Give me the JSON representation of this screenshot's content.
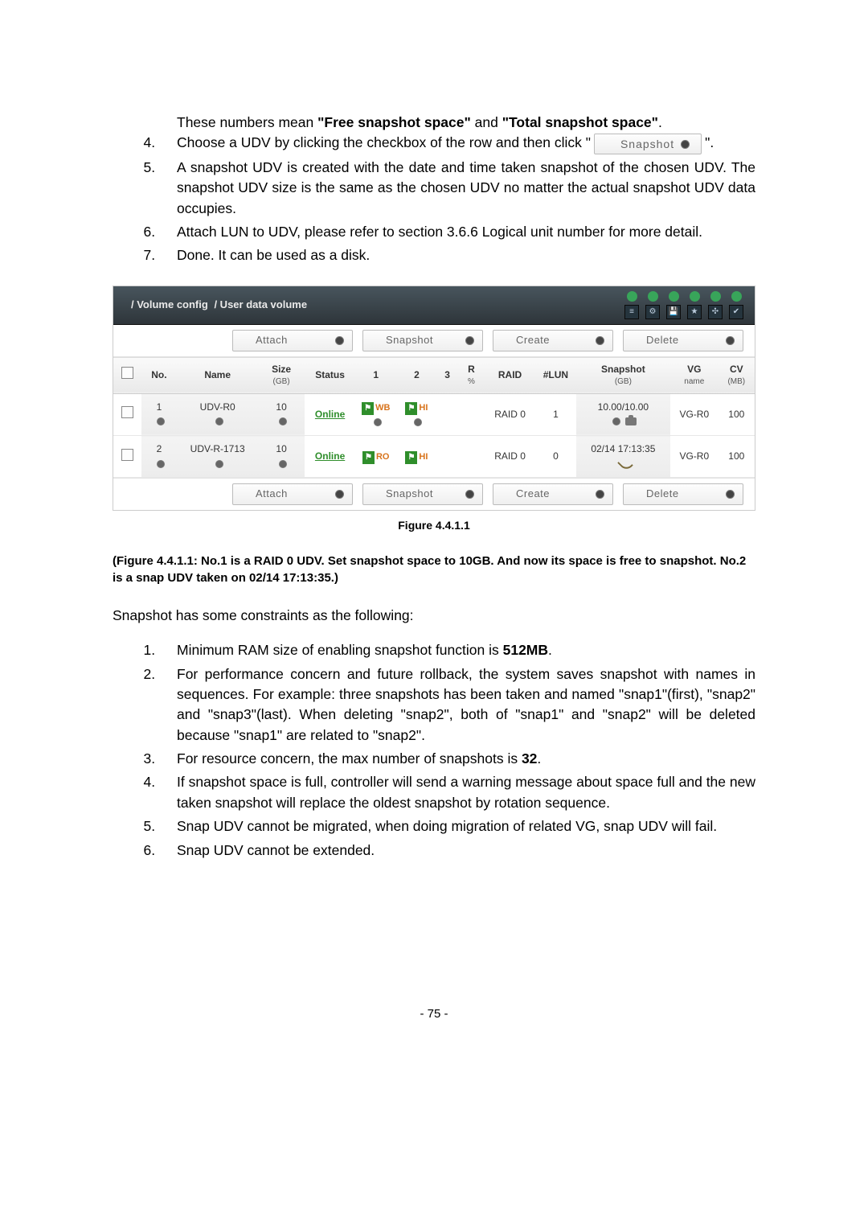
{
  "intro": {
    "line1_pre": "These numbers mean ",
    "bold1": "\"Free snapshot space\"",
    "mid": " and ",
    "bold2": "\"Total snapshot space\"",
    "post": "."
  },
  "ol1": {
    "item4_pre": "Choose a UDV by clicking the checkbox of the row and then click \"",
    "snapshot_btn": "Snapshot",
    "item4_post": "\".",
    "item5": "A snapshot UDV is created with the date and time taken snapshot of the chosen UDV. The snapshot UDV size is the same as the chosen UDV no matter the actual snapshot UDV data occupies.",
    "item6": "Attach LUN to UDV, please refer to section 3.6.6 Logical unit number for more detail.",
    "item7": "Done. It can be used as a disk."
  },
  "breadcrumb": [
    "/ Volume config",
    "/ User data volume"
  ],
  "actions": {
    "attach": "Attach",
    "snapshot": "Snapshot",
    "create": "Create",
    "delete": "Delete"
  },
  "thead": {
    "no": "No.",
    "name": "Name",
    "size": "Size",
    "size_sub": "(GB)",
    "status": "Status",
    "c1": "1",
    "c2": "2",
    "c3": "3",
    "r": "R",
    "r_sub": "%",
    "raid": "RAID",
    "lun": "#LUN",
    "snap": "Snapshot",
    "snap_sub": "(GB)",
    "vg": "VG",
    "vg_sub": "name",
    "cv": "CV",
    "cv_sub": "(MB)"
  },
  "rows": [
    {
      "no": "1",
      "name": "UDV-R0",
      "size": "10",
      "status": "Online",
      "c1": "WB",
      "c2": "HI",
      "c3": "",
      "raid": "RAID 0",
      "lun": "1",
      "snap": "10.00/10.00",
      "snap_mode": "cam",
      "vg": "VG-R0",
      "cv": "100"
    },
    {
      "no": "2",
      "name": "UDV-R-1713",
      "size": "10",
      "status": "Online",
      "c1": "RO",
      "c2": "HI",
      "c3": "",
      "raid": "RAID 0",
      "lun": "0",
      "snap": "02/14 17:13:35",
      "snap_mode": "undo",
      "vg": "VG-R0",
      "cv": "100"
    }
  ],
  "fig_caption": "Figure 4.4.1.1",
  "fig_desc": "(Figure 4.4.1.1: No.1 is a RAID 0 UDV. Set snapshot space to 10GB. And now its space is free to snapshot. No.2 is a snap UDV taken on 02/14 17:13:35.)",
  "snap_intro": "Snapshot has some constraints as the following:",
  "ol2": {
    "i1_pre": "Minimum RAM size of enabling snapshot function is ",
    "i1_bold": "512MB",
    "i1_post": ".",
    "i2": "For performance concern and future rollback, the system saves snapshot with names in sequences. For example: three snapshots has been taken and named \"snap1\"(first), \"snap2\" and \"snap3\"(last). When deleting \"snap2\", both of \"snap1\" and \"snap2\" will be deleted because \"snap1\" are related to \"snap2\".",
    "i3_pre": "For resource concern, the max number of snapshots is ",
    "i3_bold": "32",
    "i3_post": ".",
    "i4": "If snapshot space is full, controller will send a warning message about space full and the new taken snapshot will replace the oldest snapshot by rotation sequence.",
    "i5": "Snap UDV cannot be migrated, when doing migration of related VG, snap UDV will fail.",
    "i6": "Snap UDV cannot be extended."
  },
  "page_num": "- 75 -"
}
